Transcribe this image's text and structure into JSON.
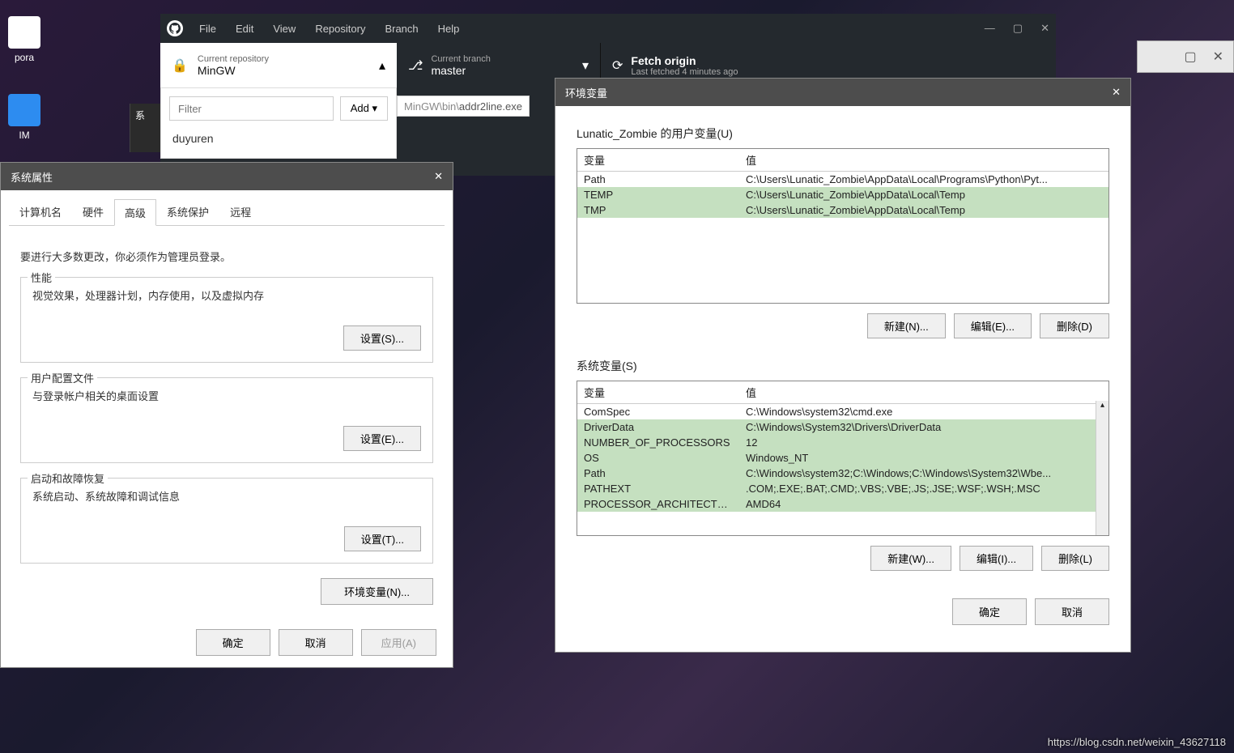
{
  "desktop": {
    "icon1_label": "pora",
    "icon2_label": "IM"
  },
  "github": {
    "menu": [
      "File",
      "Edit",
      "View",
      "Repository",
      "Branch",
      "Help"
    ],
    "repo_label": "Current repository",
    "repo_value": "MinGW",
    "branch_label": "Current branch",
    "branch_value": "master",
    "fetch_title": "Fetch origin",
    "fetch_sub": "Last fetched 4 minutes ago",
    "filter_placeholder": "Filter",
    "add_label": "Add",
    "repo_item": "duyuren",
    "path_prefix": "MinGW\\bin\\",
    "path_file": "addr2line.exe"
  },
  "sysprop": {
    "title": "系统属性",
    "tabs": [
      "计算机名",
      "硬件",
      "高级",
      "系统保护",
      "远程"
    ],
    "intro": "要进行大多数更改，你必须作为管理员登录。",
    "perf_title": "性能",
    "perf_desc": "视觉效果，处理器计划，内存使用，以及虚拟内存",
    "perf_btn": "设置(S)...",
    "profile_title": "用户配置文件",
    "profile_desc": "与登录帐户相关的桌面设置",
    "profile_btn": "设置(E)...",
    "startup_title": "启动和故障恢复",
    "startup_desc": "系统启动、系统故障和调试信息",
    "startup_btn": "设置(T)...",
    "envvar_btn": "环境变量(N)...",
    "ok": "确定",
    "cancel": "取消",
    "apply": "应用(A)"
  },
  "env": {
    "title": "环境变量",
    "user_label": "Lunatic_Zombie 的用户变量(U)",
    "col_name": "变量",
    "col_value": "值",
    "user_vars": [
      {
        "name": "Path",
        "value": "C:\\Users\\Lunatic_Zombie\\AppData\\Local\\Programs\\Python\\Pyt...",
        "hl": false
      },
      {
        "name": "TEMP",
        "value": "C:\\Users\\Lunatic_Zombie\\AppData\\Local\\Temp",
        "hl": true
      },
      {
        "name": "TMP",
        "value": "C:\\Users\\Lunatic_Zombie\\AppData\\Local\\Temp",
        "hl": true
      }
    ],
    "user_new": "新建(N)...",
    "user_edit": "编辑(E)...",
    "user_del": "删除(D)",
    "sys_label": "系统变量(S)",
    "sys_vars": [
      {
        "name": "ComSpec",
        "value": "C:\\Windows\\system32\\cmd.exe",
        "hl": false
      },
      {
        "name": "DriverData",
        "value": "C:\\Windows\\System32\\Drivers\\DriverData",
        "hl": true
      },
      {
        "name": "NUMBER_OF_PROCESSORS",
        "value": "12",
        "hl": true
      },
      {
        "name": "OS",
        "value": "Windows_NT",
        "hl": true
      },
      {
        "name": "Path",
        "value": "C:\\Windows\\system32;C:\\Windows;C:\\Windows\\System32\\Wbe...",
        "hl": true
      },
      {
        "name": "PATHEXT",
        "value": ".COM;.EXE;.BAT;.CMD;.VBS;.VBE;.JS;.JSE;.WSF;.WSH;.MSC",
        "hl": true
      },
      {
        "name": "PROCESSOR_ARCHITECTURE",
        "value": "AMD64",
        "hl": true
      }
    ],
    "sys_new": "新建(W)...",
    "sys_edit": "编辑(I)...",
    "sys_del": "删除(L)",
    "ok": "确定",
    "cancel": "取消"
  },
  "watermark": "https://blog.csdn.net/weixin_43627118",
  "back_label": "系"
}
